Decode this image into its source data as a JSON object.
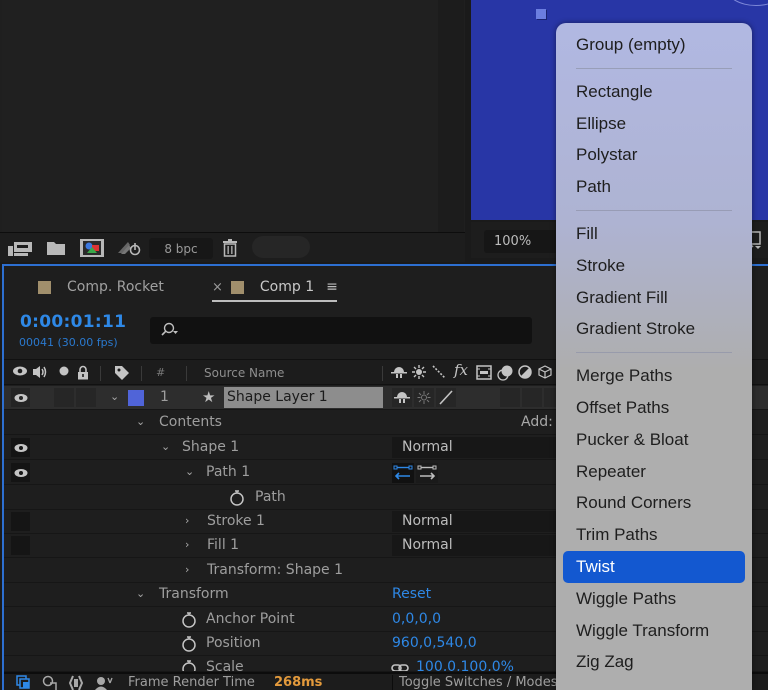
{
  "project_panel": {
    "toolbar": {
      "bpc_label": "8 bpc",
      "icons": [
        "interpret-footage-icon",
        "new-folder-icon",
        "new-composition-icon",
        "render-queue-icon",
        "trash-icon"
      ]
    }
  },
  "viewer": {
    "zoom_level": "100%",
    "canvas_color": "#2836a6"
  },
  "timeline": {
    "tabs": [
      {
        "label": "Comp. Rocket",
        "active": false
      },
      {
        "label": "Comp 1",
        "active": true,
        "close": "×",
        "menu": "≡"
      }
    ],
    "timecode": "0:00:01:11",
    "frame_info": "00041 (30.00 fps)",
    "search": {
      "placeholder": "",
      "value": ""
    },
    "header": {
      "hash": "#",
      "source_name": "Source Name"
    },
    "layer": {
      "index": "1",
      "name": "Shape Layer 1",
      "label_color": "#5064d8"
    },
    "rows": [
      {
        "label": "Contents",
        "expanded": true,
        "right_text": "Add:"
      },
      {
        "label": "Shape 1",
        "expanded": true,
        "mode": "Normal"
      },
      {
        "label": "Path 1",
        "expanded": true
      },
      {
        "label": "Path"
      },
      {
        "label": "Stroke 1",
        "expanded": false,
        "mode": "Normal"
      },
      {
        "label": "Fill 1",
        "expanded": false,
        "mode": "Normal"
      },
      {
        "label": "Transform: Shape 1",
        "expanded": false
      },
      {
        "label": "Transform",
        "expanded": true,
        "value": "Reset"
      },
      {
        "label": "Anchor Point",
        "value": "0,0,0,0"
      },
      {
        "label": "Position",
        "value": "960,0,540,0"
      },
      {
        "label": "Scale",
        "value": "100,0,100,0%"
      }
    ],
    "status": {
      "frame_render_label": "Frame Render Time",
      "frame_render_value": "268ms",
      "toggle_label": "Toggle Switches / Modes"
    },
    "accent_color": "#2e88e6"
  },
  "add_menu": {
    "groups": [
      [
        "Group (empty)"
      ],
      [
        "Rectangle",
        "Ellipse",
        "Polystar",
        "Path"
      ],
      [
        "Fill",
        "Stroke",
        "Gradient Fill",
        "Gradient Stroke"
      ],
      [
        "Merge Paths",
        "Offset Paths",
        "Pucker & Bloat",
        "Repeater",
        "Round Corners",
        "Trim Paths",
        "Twist",
        "Wiggle Paths",
        "Wiggle Transform",
        "Zig Zag"
      ]
    ],
    "selected": "Twist",
    "selected_color": "#1358d0"
  }
}
